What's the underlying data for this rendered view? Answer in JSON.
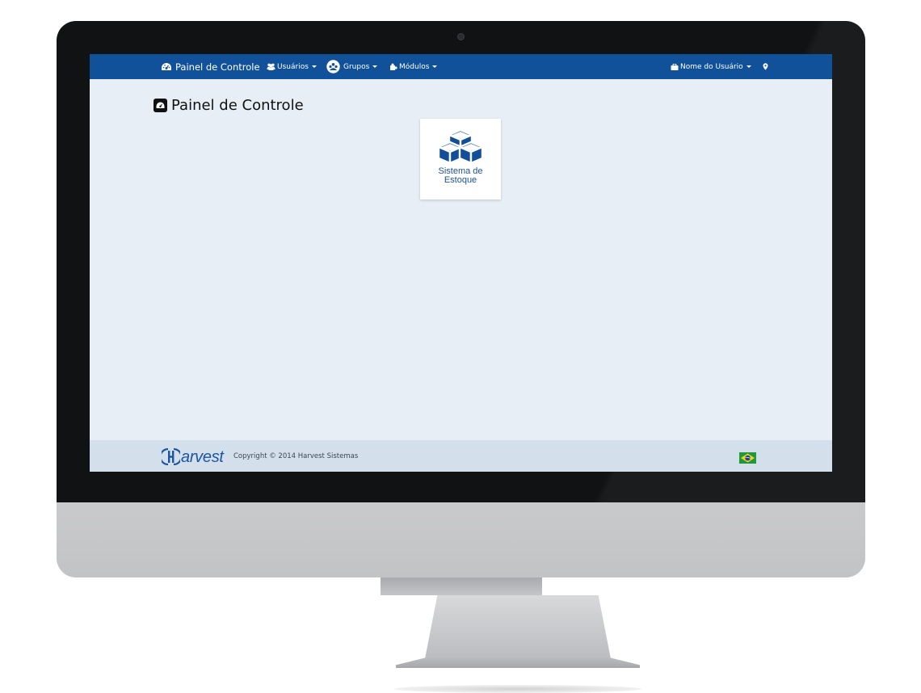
{
  "navbar": {
    "brand": "Painel de Controle",
    "menus": [
      {
        "label": "Usuários",
        "icon": "users-icon"
      },
      {
        "label": "Grupos",
        "icon": "group-icon"
      },
      {
        "label": "Módulos",
        "icon": "puzzle-icon"
      }
    ],
    "user_menu": {
      "label": "Nome do Usuário",
      "icon": "briefcase-icon"
    },
    "location_icon": "map-marker-icon"
  },
  "main": {
    "page_title": "Painel de Controle",
    "title_icon": "dashboard-icon",
    "modules": [
      {
        "label_line1": "Sistema de",
        "label_line2": "Estoque",
        "icon": "cubes-icon"
      }
    ]
  },
  "footer": {
    "logo_text": "arvest",
    "copyright": "Copyright © 2014 Harvest Sistemas",
    "language_flag": "brazil-flag-icon"
  },
  "colors": {
    "navbar": "#10519a",
    "page_background": "#e7eef6",
    "footer": "#d3dfea",
    "accent_blue": "#1d5294"
  }
}
